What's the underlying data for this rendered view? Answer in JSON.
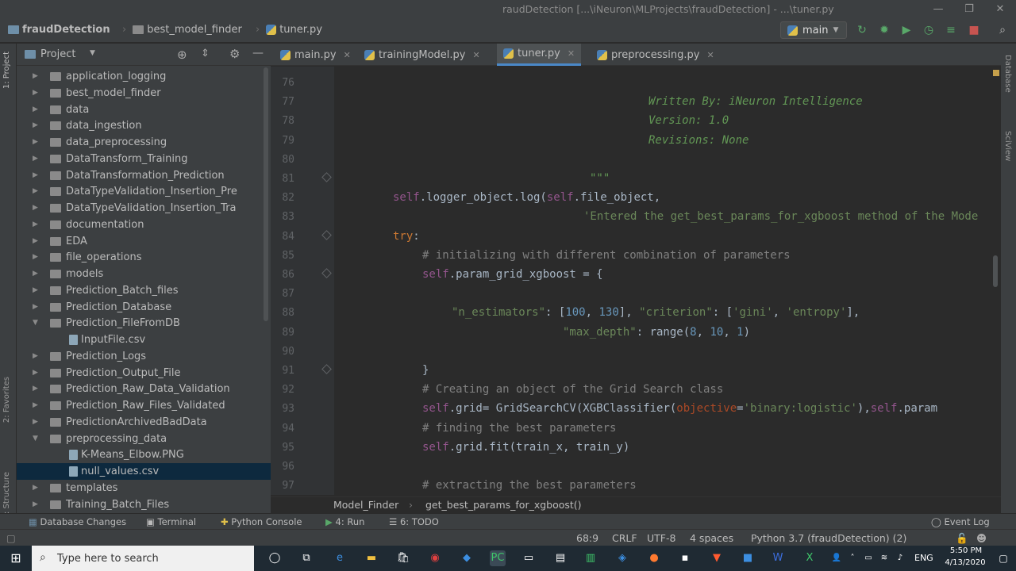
{
  "window": {
    "title": "raudDetection [...\\iNeuron\\MLProjects\\fraudDetection] - ...\\tuner.py"
  },
  "navbar": {
    "crumbs": [
      "fraudDetection",
      "best_model_finder",
      "tuner.py"
    ],
    "branch": "main"
  },
  "project": {
    "title": "Project",
    "items": [
      {
        "label": "application_logging",
        "type": "folder",
        "level": 1,
        "open": false
      },
      {
        "label": "best_model_finder",
        "type": "folder",
        "level": 1,
        "open": false
      },
      {
        "label": "data",
        "type": "folder",
        "level": 1,
        "open": false
      },
      {
        "label": "data_ingestion",
        "type": "folder",
        "level": 1,
        "open": false
      },
      {
        "label": "data_preprocessing",
        "type": "folder",
        "level": 1,
        "open": false
      },
      {
        "label": "DataTransform_Training",
        "type": "folder",
        "level": 1,
        "open": false
      },
      {
        "label": "DataTransformation_Prediction",
        "type": "folder",
        "level": 1,
        "open": false
      },
      {
        "label": "DataTypeValidation_Insertion_Pre",
        "type": "folder",
        "level": 1,
        "open": false
      },
      {
        "label": "DataTypeValidation_Insertion_Tra",
        "type": "folder",
        "level": 1,
        "open": false
      },
      {
        "label": "documentation",
        "type": "folder",
        "level": 1,
        "open": false
      },
      {
        "label": "EDA",
        "type": "folder",
        "level": 1,
        "open": false
      },
      {
        "label": "file_operations",
        "type": "folder",
        "level": 1,
        "open": false
      },
      {
        "label": "models",
        "type": "folder",
        "level": 1,
        "open": false
      },
      {
        "label": "Prediction_Batch_files",
        "type": "folder",
        "level": 1,
        "open": false
      },
      {
        "label": "Prediction_Database",
        "type": "folder",
        "level": 1,
        "open": false
      },
      {
        "label": "Prediction_FileFromDB",
        "type": "folder",
        "level": 1,
        "open": true
      },
      {
        "label": "InputFile.csv",
        "type": "file",
        "level": 2
      },
      {
        "label": "Prediction_Logs",
        "type": "folder",
        "level": 1,
        "open": false
      },
      {
        "label": "Prediction_Output_File",
        "type": "folder",
        "level": 1,
        "open": false
      },
      {
        "label": "Prediction_Raw_Data_Validation",
        "type": "folder",
        "level": 1,
        "open": false
      },
      {
        "label": "Prediction_Raw_Files_Validated",
        "type": "folder",
        "level": 1,
        "open": false
      },
      {
        "label": "PredictionArchivedBadData",
        "type": "folder",
        "level": 1,
        "open": false
      },
      {
        "label": "preprocessing_data",
        "type": "folder",
        "level": 1,
        "open": true
      },
      {
        "label": "K-Means_Elbow.PNG",
        "type": "file",
        "level": 2
      },
      {
        "label": "null_values.csv",
        "type": "file",
        "level": 2,
        "selected": true
      },
      {
        "label": "templates",
        "type": "folder",
        "level": 1,
        "open": false
      },
      {
        "label": "Training_Batch_Files",
        "type": "folder",
        "level": 1,
        "open": false
      }
    ]
  },
  "tabs": [
    {
      "label": "main.py",
      "active": false
    },
    {
      "label": "trainingModel.py",
      "active": false
    },
    {
      "label": "tuner.py",
      "active": true
    },
    {
      "label": "preprocessing.py",
      "active": false
    }
  ],
  "editor": {
    "lines": [
      {
        "n": "76",
        "indent": 0,
        "tokens": []
      },
      {
        "n": "77",
        "indent": 396,
        "tokens": [
          {
            "t": "Written By: iNeuron Intelligence",
            "c": "doc"
          }
        ]
      },
      {
        "n": "78",
        "indent": 396,
        "tokens": [
          {
            "t": "Version: 1.0",
            "c": "doc"
          }
        ]
      },
      {
        "n": "79",
        "indent": 396,
        "tokens": [
          {
            "t": "Revisions: None",
            "c": "doc"
          }
        ]
      },
      {
        "n": "80",
        "indent": 0,
        "tokens": []
      },
      {
        "n": "81",
        "indent": 322,
        "tokens": [
          {
            "t": "\"\"\"",
            "c": "doc"
          }
        ]
      },
      {
        "n": "82",
        "indent": 74,
        "tokens": [
          {
            "t": "self",
            "c": "self"
          },
          {
            "t": ".logger_object.log(",
            "c": "fn"
          },
          {
            "t": "self",
            "c": "self"
          },
          {
            "t": ".file_object,",
            "c": "fn"
          }
        ]
      },
      {
        "n": "83",
        "indent": 314,
        "tokens": [
          {
            "t": "'Entered the get_best_params_for_xgboost method of the Mode",
            "c": "str"
          }
        ]
      },
      {
        "n": "84",
        "indent": 74,
        "tokens": [
          {
            "t": "try",
            "c": "kw"
          },
          {
            "t": ":",
            "c": "fn"
          }
        ]
      },
      {
        "n": "85",
        "indent": 111,
        "tokens": [
          {
            "t": "# initializing with different combination of parameters",
            "c": "cm"
          }
        ]
      },
      {
        "n": "86",
        "indent": 111,
        "tokens": [
          {
            "t": "self",
            "c": "self"
          },
          {
            "t": ".param_grid_xgboost = {",
            "c": "fn"
          }
        ]
      },
      {
        "n": "87",
        "indent": 0,
        "tokens": []
      },
      {
        "n": "88",
        "indent": 148,
        "tokens": [
          {
            "t": "\"n_estimators\"",
            "c": "str"
          },
          {
            "t": ": [",
            "c": "fn"
          },
          {
            "t": "100",
            "c": "num"
          },
          {
            "t": ", ",
            "c": "fn"
          },
          {
            "t": "130",
            "c": "num"
          },
          {
            "t": "], ",
            "c": "fn"
          },
          {
            "t": "\"criterion\"",
            "c": "str"
          },
          {
            "t": ": [",
            "c": "fn"
          },
          {
            "t": "'gini'",
            "c": "str"
          },
          {
            "t": ", ",
            "c": "fn"
          },
          {
            "t": "'entropy'",
            "c": "str"
          },
          {
            "t": "],",
            "c": "fn"
          }
        ]
      },
      {
        "n": "89",
        "indent": 288,
        "tokens": [
          {
            "t": "\"max_depth\"",
            "c": "str"
          },
          {
            "t": ": range(",
            "c": "fn"
          },
          {
            "t": "8",
            "c": "num"
          },
          {
            "t": ", ",
            "c": "fn"
          },
          {
            "t": "10",
            "c": "num"
          },
          {
            "t": ", ",
            "c": "fn"
          },
          {
            "t": "1",
            "c": "num"
          },
          {
            "t": ")",
            "c": "fn"
          }
        ]
      },
      {
        "n": "90",
        "indent": 0,
        "tokens": []
      },
      {
        "n": "91",
        "indent": 111,
        "tokens": [
          {
            "t": "}",
            "c": "fn"
          }
        ]
      },
      {
        "n": "92",
        "indent": 111,
        "tokens": [
          {
            "t": "# Creating an object of the Grid Search class",
            "c": "cm"
          }
        ]
      },
      {
        "n": "93",
        "indent": 111,
        "tokens": [
          {
            "t": "self",
            "c": "self"
          },
          {
            "t": ".grid= GridSearchCV(XGBClassifier(",
            "c": "fn"
          },
          {
            "t": "objective",
            "c": "named"
          },
          {
            "t": "=",
            "c": "fn"
          },
          {
            "t": "'binary:logistic'",
            "c": "str"
          },
          {
            "t": "),",
            "c": "fn"
          },
          {
            "t": "self",
            "c": "self"
          },
          {
            "t": ".param",
            "c": "fn"
          }
        ]
      },
      {
        "n": "94",
        "indent": 111,
        "tokens": [
          {
            "t": "# finding the best parameters",
            "c": "cm"
          }
        ]
      },
      {
        "n": "95",
        "indent": 111,
        "tokens": [
          {
            "t": "self",
            "c": "self"
          },
          {
            "t": ".grid.fit(train_x, train_y)",
            "c": "fn"
          }
        ]
      },
      {
        "n": "96",
        "indent": 0,
        "tokens": []
      },
      {
        "n": "97",
        "indent": 111,
        "tokens": [
          {
            "t": "# extracting the best parameters",
            "c": "cm"
          }
        ]
      }
    ]
  },
  "breadcrumb": [
    "Model_Finder",
    "get_best_params_for_xgboost()"
  ],
  "toolwindows": [
    "Database Changes",
    "Terminal",
    "Python Console",
    "4: Run",
    "6: TODO",
    "Event Log"
  ],
  "status": {
    "position": "68:9",
    "line_sep": "CRLF",
    "encoding": "UTF-8",
    "indent": "4 spaces",
    "interpreter": "Python 3.7 (fraudDetection) (2)"
  },
  "side_labels": {
    "left": [
      "1: Project",
      "2: Favorites",
      "7: Structure"
    ],
    "right": [
      "Database",
      "SciView"
    ]
  },
  "taskbar": {
    "search_placeholder": "Type here to search",
    "lang": "ENG",
    "time": "5:50 PM",
    "date": "4/13/2020"
  }
}
